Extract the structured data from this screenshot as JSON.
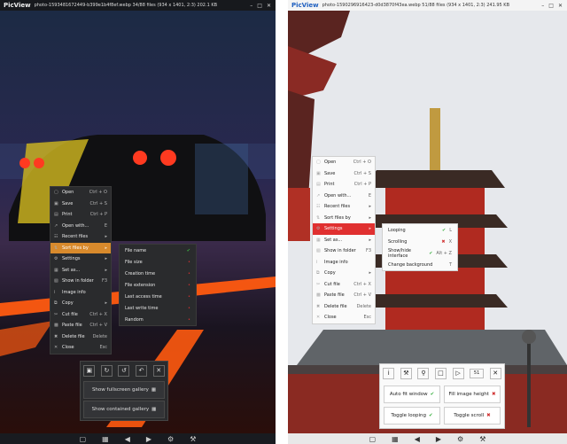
{
  "left": {
    "logo": "PicView",
    "title": "photo-1593481672449-b399e1b4f8ef.webp 34/88 files (934 x 1401, 2:3) 202.1 KB",
    "menu": [
      {
        "label": "Open",
        "shortcut": "Ctrl + O"
      },
      {
        "label": "Save",
        "shortcut": "Ctrl + S"
      },
      {
        "label": "Print",
        "shortcut": "Ctrl + P"
      },
      {
        "label": "Open with...",
        "shortcut": "E"
      },
      {
        "label": "Recent files",
        "shortcut": ""
      },
      {
        "label": "Sort files by",
        "shortcut": ""
      },
      {
        "label": "Settings",
        "shortcut": ""
      },
      {
        "label": "Set as...",
        "shortcut": ""
      },
      {
        "label": "Show in folder",
        "shortcut": "F3"
      },
      {
        "label": "Image info",
        "shortcut": ""
      },
      {
        "label": "Copy",
        "shortcut": ""
      },
      {
        "label": "Cut file",
        "shortcut": "Ctrl + X"
      },
      {
        "label": "Paste file",
        "shortcut": "Ctrl + V"
      },
      {
        "label": "Delete file",
        "shortcut": "Delete"
      },
      {
        "label": "Close",
        "shortcut": "Esc"
      }
    ],
    "submenu": [
      "File name",
      "File size",
      "Creation time",
      "File extension",
      "Last access time",
      "Last write time",
      "Random"
    ],
    "toolbox": {
      "fullscreen_gallery": "Show fullscreen gallery",
      "contained_gallery": "Show contained gallery"
    }
  },
  "right": {
    "logo": "PicView",
    "title": "photo-1590296916423-d0d3870f43ea.webp 51/88 files (934 x 1401, 2:3) 241.95 KB",
    "menu": [
      {
        "label": "Open",
        "shortcut": "Ctrl + O"
      },
      {
        "label": "Save",
        "shortcut": "Ctrl + S"
      },
      {
        "label": "Print",
        "shortcut": "Ctrl + P"
      },
      {
        "label": "Open with...",
        "shortcut": "E"
      },
      {
        "label": "Recent files",
        "shortcut": ""
      },
      {
        "label": "Sort files by",
        "shortcut": ""
      },
      {
        "label": "Settings",
        "shortcut": ""
      },
      {
        "label": "Set as...",
        "shortcut": ""
      },
      {
        "label": "Show in folder",
        "shortcut": "F3"
      },
      {
        "label": "Image info",
        "shortcut": ""
      },
      {
        "label": "Copy",
        "shortcut": ""
      },
      {
        "label": "Cut file",
        "shortcut": "Ctrl + X"
      },
      {
        "label": "Paste file",
        "shortcut": "Ctrl + V"
      },
      {
        "label": "Delete file",
        "shortcut": "Delete"
      },
      {
        "label": "Close",
        "shortcut": "Esc"
      }
    ],
    "submenu": [
      {
        "label": "Looping",
        "mark": "✔",
        "shortcut": "L"
      },
      {
        "label": "Scrolling",
        "mark": "✖",
        "shortcut": "X"
      },
      {
        "label": "Show/hide interface",
        "mark": "✔",
        "shortcut": "Alt + Z"
      },
      {
        "label": "Change background",
        "mark": "",
        "shortcut": "T"
      }
    ],
    "toolbox": {
      "zoom_value": "51",
      "auto_fit": "Auto fit window",
      "fill_height": "Fill image height",
      "toggle_looping": "Toggle looping",
      "toggle_scroll": "Toggle scroll"
    }
  },
  "colors": {
    "accent_left": "#d88a2c",
    "accent_right": "#e03030",
    "check": "#3cb043"
  }
}
